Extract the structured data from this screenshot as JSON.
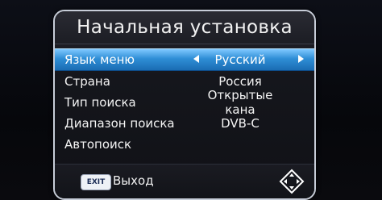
{
  "title": "Начальная установка",
  "menu": {
    "items": [
      {
        "label": "Язык меню",
        "value": "Русский",
        "selected": true
      },
      {
        "label": "Страна",
        "value": "Россия",
        "selected": false
      },
      {
        "label": "Тип поиска",
        "value": "Открытые кана",
        "selected": false
      },
      {
        "label": "Диапазон поиска",
        "value": "DVB-C",
        "selected": false
      },
      {
        "label": "Автопоиск",
        "value": "",
        "selected": false
      }
    ]
  },
  "footer": {
    "exit_key": "EXIT",
    "exit_label": "Выход",
    "nav_icon": "navigation-arrows-icon"
  },
  "colors": {
    "highlight": "#2f8ed6",
    "frame_border": "#c7cdd8",
    "text": "#f4f4f4"
  }
}
